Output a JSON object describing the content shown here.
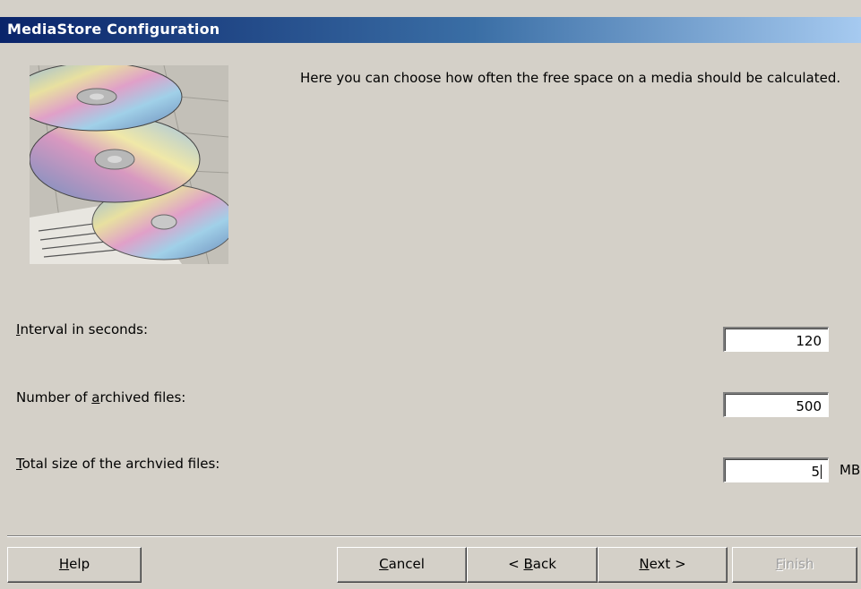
{
  "window": {
    "title": "MediaStore Configuration"
  },
  "intro_text": "Here you can choose how often the free space on a media should be calculated.",
  "fields": {
    "interval": {
      "label_key": "I",
      "label_rest": "nterval in seconds:",
      "value": "120"
    },
    "archived_count": {
      "label_pre": "Number of ",
      "label_key": "a",
      "label_rest": "rchived files:",
      "value": "500"
    },
    "total_size": {
      "label_key": "T",
      "label_rest": "otal size of the archvied files:",
      "value": "5",
      "unit": "MB"
    }
  },
  "buttons": {
    "help": {
      "key": "H",
      "rest": "elp"
    },
    "cancel": {
      "key": "C",
      "rest": "ancel"
    },
    "back": {
      "pre": "< ",
      "key": "B",
      "rest": "ack"
    },
    "next": {
      "key": "N",
      "rest": "ext >"
    },
    "finish": {
      "key": "F",
      "rest": "inish",
      "enabled": false
    }
  },
  "icons": {
    "illustration": "cd-discs-image"
  }
}
